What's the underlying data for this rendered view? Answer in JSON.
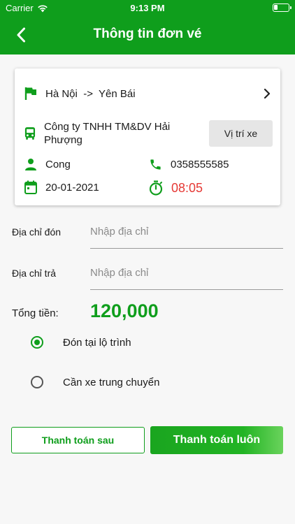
{
  "status_bar": {
    "carrier": "Carrier",
    "time": "9:13 PM"
  },
  "header": {
    "title": "Thông tin đơn vé"
  },
  "trip": {
    "origin": "Hà Nội",
    "arrow": "->",
    "destination": "Yên Bái",
    "company": "Công ty TNHH TM&DV Hải Phượng",
    "location_button": "Vị trí xe",
    "passenger": "Cong",
    "phone": "0358555585",
    "date": "20-01-2021",
    "departure_time": "08:05"
  },
  "form": {
    "pickup": {
      "label": "Địa chỉ đón",
      "placeholder": "Nhập địa chỉ",
      "value": ""
    },
    "dropoff": {
      "label": "Địa chỉ trả",
      "placeholder": "Nhập địa chỉ",
      "value": ""
    }
  },
  "total": {
    "label": "Tổng tiền:",
    "amount": "120,000"
  },
  "pickup_options": [
    {
      "label": "Đón tại lộ trình",
      "selected": true
    },
    {
      "label": "Cần xe trung chuyển",
      "selected": false
    }
  ],
  "actions": {
    "pay_later": "Thanh toán sau",
    "pay_now": "Thanh toán luôn"
  },
  "colors": {
    "primary": "#0f9e1c",
    "time_red": "#e53935",
    "button_gray": "#e6e6e6"
  },
  "icons": [
    "wifi-icon",
    "battery-icon",
    "back-arrow-icon",
    "flag-icon",
    "chevron-right-icon",
    "bus-icon",
    "person-icon",
    "phone-icon",
    "calendar-icon",
    "timer-icon"
  ]
}
